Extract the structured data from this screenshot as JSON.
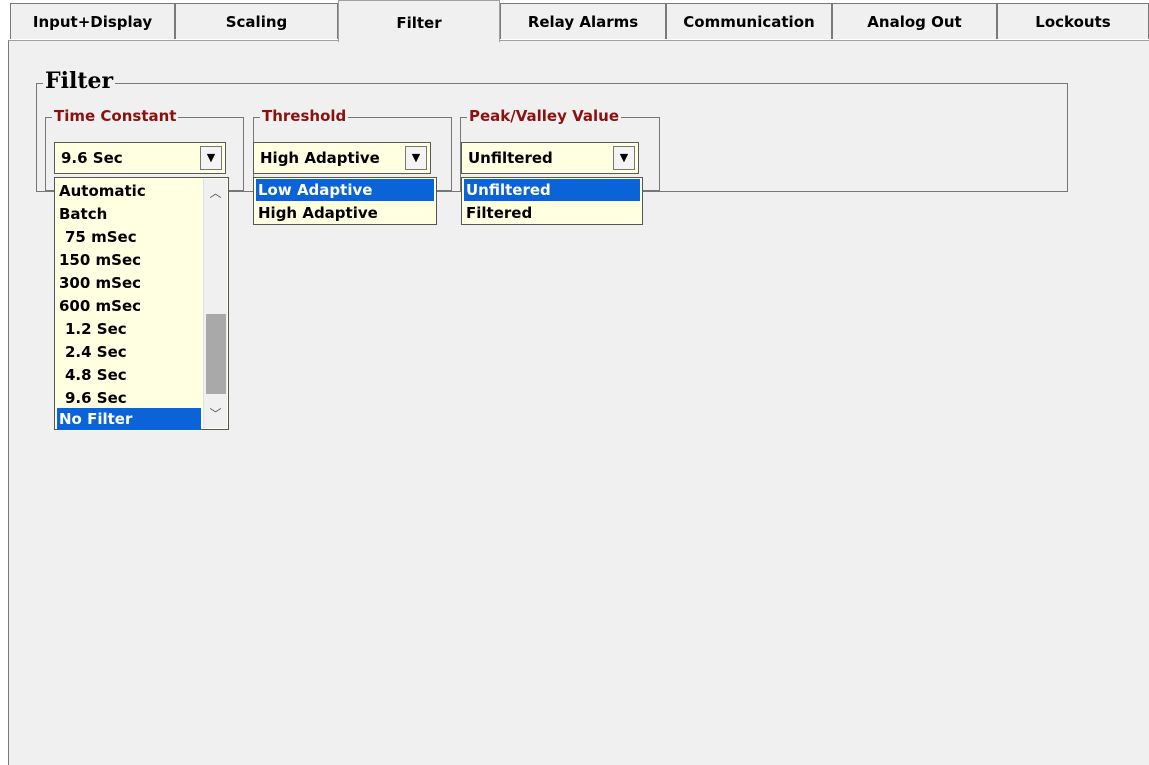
{
  "tabs": [
    {
      "label": "Input+Display"
    },
    {
      "label": "Scaling"
    },
    {
      "label": "Filter"
    },
    {
      "label": "Relay Alarms"
    },
    {
      "label": "Communication"
    },
    {
      "label": "Analog Out"
    },
    {
      "label": "Lockouts"
    }
  ],
  "active_tab": "Filter",
  "filter": {
    "title": "Filter",
    "time_constant": {
      "legend": "Time Constant",
      "value": "9.6 Sec",
      "options": [
        "Automatic",
        "Batch",
        "75 mSec",
        "150 mSec",
        "300 mSec",
        "600 mSec",
        "1.2 Sec",
        "2.4 Sec",
        "4.8 Sec",
        "9.6 Sec",
        "No Filter"
      ],
      "highlighted": "No Filter"
    },
    "threshold": {
      "legend": "Threshold",
      "value": "High Adaptive",
      "options": [
        "Low Adaptive",
        "High Adaptive"
      ],
      "highlighted": "Low Adaptive"
    },
    "peak_valley": {
      "legend": "Peak/Valley Value",
      "value": "Unfiltered",
      "options": [
        "Unfiltered",
        "Filtered"
      ],
      "highlighted": "Unfiltered"
    }
  },
  "colors": {
    "legend_red": "#8b1010",
    "combo_bg": "#ffffe1",
    "selection": "#0a64d8",
    "panel_bg": "#f0f0f0"
  },
  "icons": {
    "combo_arrow": "dropdown-arrow-icon",
    "scroll_up": "scroll-up-icon",
    "scroll_down": "scroll-down-icon"
  }
}
